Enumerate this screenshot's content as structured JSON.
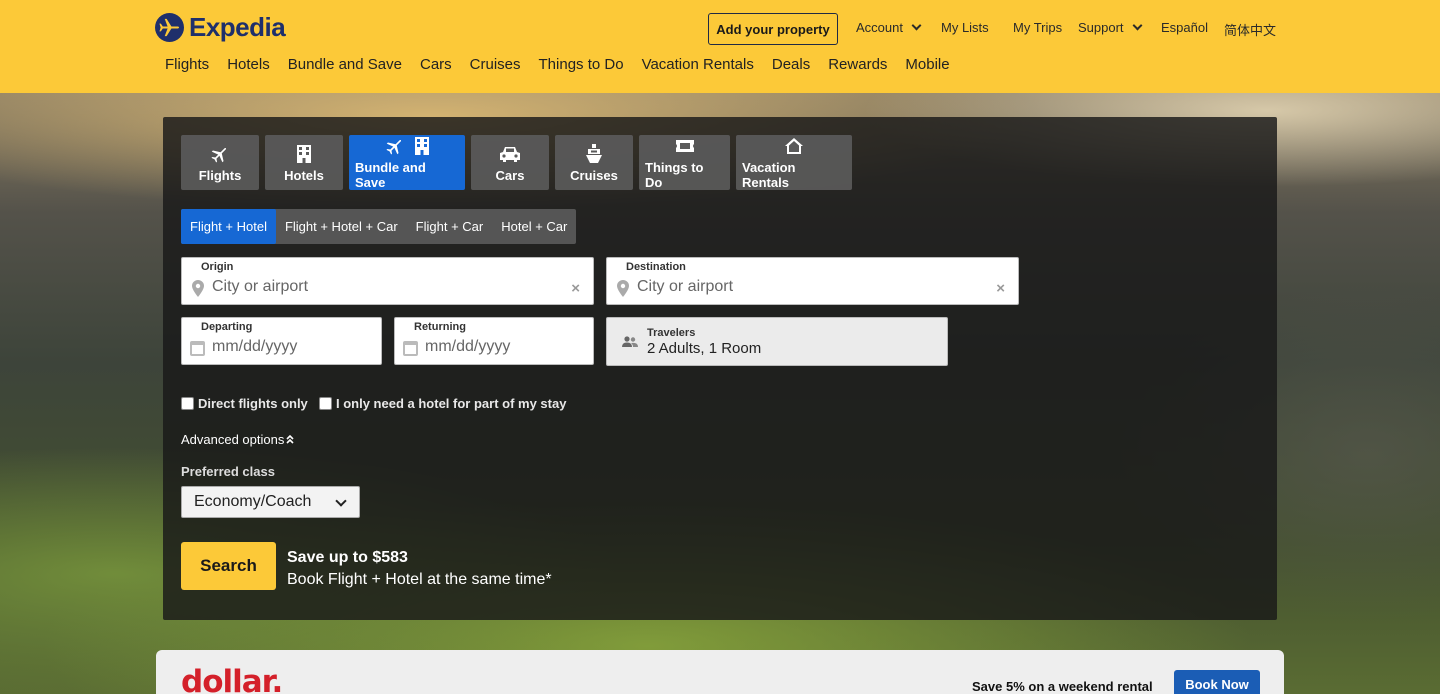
{
  "brand": {
    "name": "Expedia"
  },
  "header": {
    "add_property": "Add your property",
    "util_links": [
      {
        "label": "Account",
        "dropdown": true
      },
      {
        "label": "My Lists",
        "dropdown": false
      },
      {
        "label": "My Trips",
        "dropdown": false
      },
      {
        "label": "Support",
        "dropdown": true
      },
      {
        "label": "Español",
        "dropdown": false
      },
      {
        "label": "简体中文",
        "dropdown": false
      }
    ],
    "nav": [
      "Flights",
      "Hotels",
      "Bundle and Save",
      "Cars",
      "Cruises",
      "Things to Do",
      "Vacation Rentals",
      "Deals",
      "Rewards",
      "Mobile"
    ]
  },
  "search": {
    "tabs": [
      {
        "label": "Flights",
        "icon": "plane-icon"
      },
      {
        "label": "Hotels",
        "icon": "building-icon"
      },
      {
        "label": "Bundle and Save",
        "icon": "plane-building-icon",
        "active": true
      },
      {
        "label": "Cars",
        "icon": "car-icon"
      },
      {
        "label": "Cruises",
        "icon": "ship-icon"
      },
      {
        "label": "Things to Do",
        "icon": "ticket-icon"
      },
      {
        "label": "Vacation Rentals",
        "icon": "house-icon"
      }
    ],
    "subtabs": [
      {
        "label": "Flight + Hotel",
        "active": true
      },
      {
        "label": "Flight + Hotel + Car"
      },
      {
        "label": "Flight + Car"
      },
      {
        "label": "Hotel + Car"
      }
    ],
    "origin": {
      "label": "Origin",
      "placeholder": "City or airport"
    },
    "destination": {
      "label": "Destination",
      "placeholder": "City or airport"
    },
    "departing": {
      "label": "Departing",
      "placeholder": "mm/dd/yyyy"
    },
    "returning": {
      "label": "Returning",
      "placeholder": "mm/dd/yyyy"
    },
    "travelers": {
      "label": "Travelers",
      "value": "2 Adults, 1 Room"
    },
    "direct_flights": "Direct flights only",
    "partial_hotel": "I only need a hotel for part of my stay",
    "advanced_options": "Advanced options",
    "preferred_class": {
      "label": "Preferred class",
      "value": "Economy/Coach"
    },
    "search_button": "Search",
    "promo_title": "Save up to $583",
    "promo_sub": "Book Flight + Hotel at the same time*"
  },
  "ad": {
    "logo": "dollar.",
    "text": "Save 5% on a weekend rental",
    "button": "Book Now"
  },
  "colors": {
    "header_bg": "#fcc938",
    "accent_blue": "#1668d4",
    "brand_navy": "#1f2f6b",
    "ad_red": "#d4202a"
  }
}
